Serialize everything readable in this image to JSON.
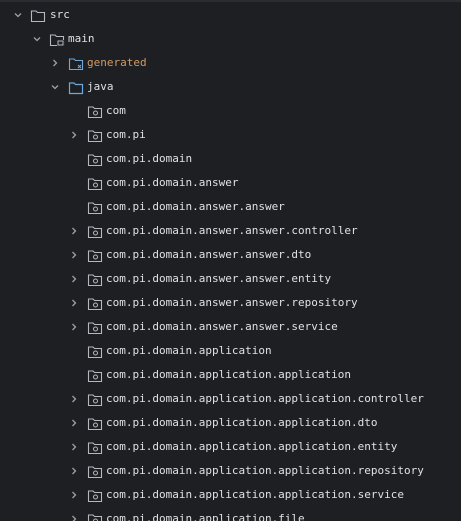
{
  "tree": {
    "src": {
      "label": "src",
      "icon": "folder-icon"
    },
    "main": {
      "label": "main",
      "icon": "source-folder-icon"
    },
    "generated": {
      "label": "generated",
      "icon": "generated-folder-icon"
    },
    "java": {
      "label": "java",
      "icon": "source-root-folder-icon"
    },
    "packages": [
      {
        "label": "com",
        "expandable": false
      },
      {
        "label": "com.pi",
        "expandable": true
      },
      {
        "label": "com.pi.domain",
        "expandable": false
      },
      {
        "label": "com.pi.domain.answer",
        "expandable": false
      },
      {
        "label": "com.pi.domain.answer.answer",
        "expandable": false
      },
      {
        "label": "com.pi.domain.answer.answer.controller",
        "expandable": true
      },
      {
        "label": "com.pi.domain.answer.answer.dto",
        "expandable": true
      },
      {
        "label": "com.pi.domain.answer.answer.entity",
        "expandable": true
      },
      {
        "label": "com.pi.domain.answer.answer.repository",
        "expandable": true
      },
      {
        "label": "com.pi.domain.answer.answer.service",
        "expandable": true
      },
      {
        "label": "com.pi.domain.application",
        "expandable": false
      },
      {
        "label": "com.pi.domain.application.application",
        "expandable": false
      },
      {
        "label": "com.pi.domain.application.application.controller",
        "expandable": true
      },
      {
        "label": "com.pi.domain.application.application.dto",
        "expandable": true
      },
      {
        "label": "com.pi.domain.application.application.entity",
        "expandable": true
      },
      {
        "label": "com.pi.domain.application.application.repository",
        "expandable": true
      },
      {
        "label": "com.pi.domain.application.application.service",
        "expandable": true
      },
      {
        "label": "com.pi.domain.application.file",
        "expandable": true
      }
    ]
  },
  "colors": {
    "background": "#1e1f22",
    "text": "#dfe1e5",
    "generated_text": "#d19a66",
    "icon_outline": "#b4b8bf",
    "source_folder_blue": "#6fa8dc",
    "chevron": "#9da0a8"
  }
}
